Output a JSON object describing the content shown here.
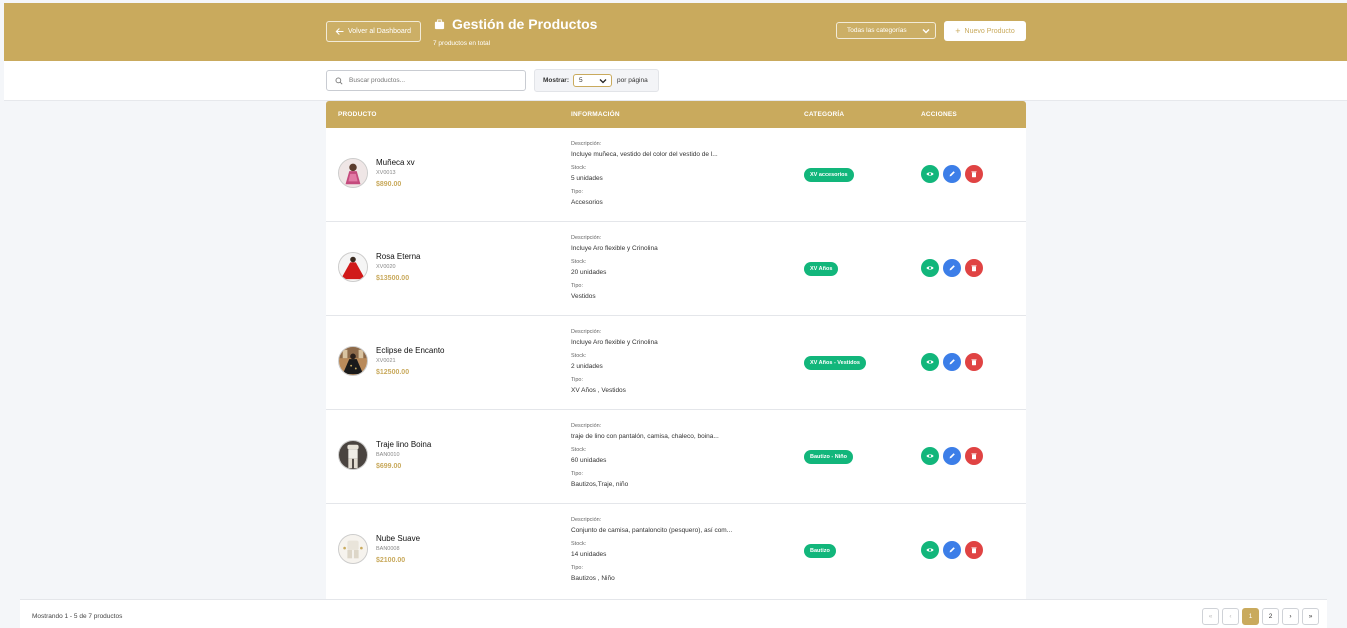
{
  "header": {
    "back_label": "Volver al Dashboard",
    "title": "Gestión de Productos",
    "subtitle": "7 productos en total",
    "category_filter": "Todas las categorías",
    "new_product_label": "Nuevo Producto",
    "background_color": "#c9aa5d"
  },
  "filters": {
    "search_placeholder": "Buscar productos...",
    "search_value": "",
    "show_label": "Mostrar:",
    "page_size": "5",
    "per_page_label": "por página"
  },
  "table": {
    "columns": [
      "PRODUCTO",
      "INFORMACIÓN",
      "CATEGORÍA",
      "ACCIONES"
    ],
    "info_labels": {
      "description": "Descripción:",
      "stock": "Stock:",
      "type": "Tipo:"
    },
    "rows": [
      {
        "name": "Muñeca xv",
        "sku": "XV0013",
        "price": "$890.00",
        "description": "Incluye muñeca, vestido del color del vestido de l...",
        "stock": "5 unidades",
        "type": "Accesorios",
        "category": "XV accesorios",
        "image": "doll"
      },
      {
        "name": "Rosa Eterna",
        "sku": "XV0020",
        "price": "$13500.00",
        "description": "Incluye Aro flexible y Crinolina",
        "stock": "20 unidades",
        "type": "Vestidos",
        "category": "XV Años",
        "image": "red-dress"
      },
      {
        "name": "Eclipse de Encanto",
        "sku": "XV0021",
        "price": "$12500.00",
        "description": "Incluye Aro flexible y Crinolina",
        "stock": "2 unidades",
        "type": "XV Años , Vestidos",
        "category": "XV Años - Vestidos",
        "image": "black-dress"
      },
      {
        "name": "Traje lino Boina",
        "sku": "BAN0010",
        "price": "$699.00",
        "description": "traje de lino con pantalón, camisa, chaleco, boina...",
        "stock": "60 unidades",
        "type": "Bautizos,Traje, niño",
        "category": "Bautizo - Niño",
        "image": "linen-suit"
      },
      {
        "name": "Nube Suave",
        "sku": "BAN0008",
        "price": "$2100.00",
        "description": "Conjunto de camisa, pantaloncito (pesquero), así com...",
        "stock": "14 unidades",
        "type": "Bautizos , Niño",
        "category": "Bautizo",
        "image": "white-outfit"
      }
    ]
  },
  "footer": {
    "showing": "Mostrando 1 - 5 de 7 productos",
    "pages": [
      "1",
      "2"
    ],
    "current_page": "1",
    "first_icon": "«",
    "prev_icon": "‹",
    "next_icon": "›",
    "last_icon": "»"
  },
  "icons": {
    "view": "eye-icon",
    "edit": "pencil-icon",
    "delete": "trash-icon",
    "category_badge_color": "#12b67b",
    "edit_color": "#3c7ee8",
    "delete_color": "#e04343"
  }
}
